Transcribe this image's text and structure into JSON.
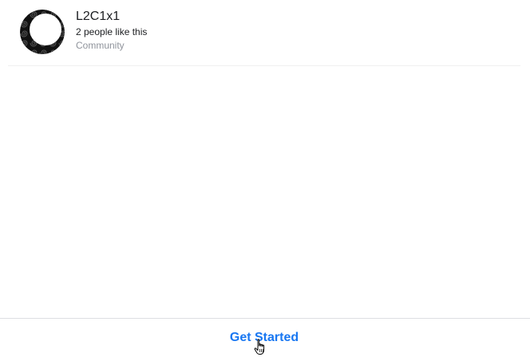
{
  "result": {
    "name": "L2C1x1",
    "likes_text": "2 people like this",
    "category": "Community",
    "avatar_icon": "crescent-moon-spiral-icon"
  },
  "footer": {
    "cta_label": "Get Started"
  },
  "cursor": {
    "icon": "hand-pointer-cursor-icon"
  },
  "colors": {
    "accent": "#1877f2",
    "text_primary": "#1c1e21",
    "text_secondary": "#90949c",
    "divider": "#dddfe2"
  }
}
